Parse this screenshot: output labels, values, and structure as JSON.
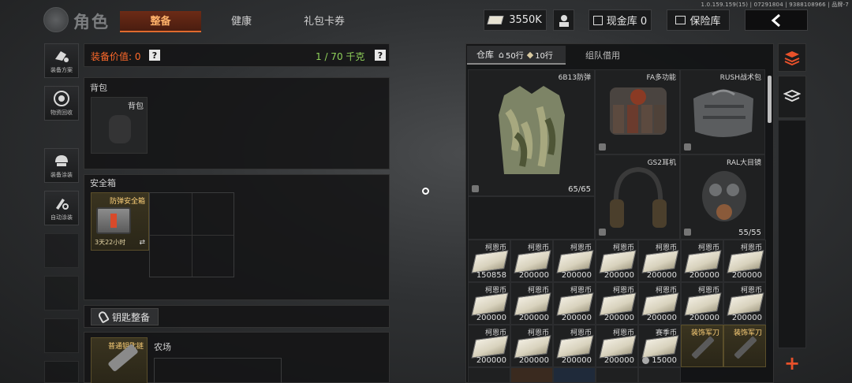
{
  "version": "1.0.159.159(15) | 07291804 | 9388108966 | 品牌-7",
  "header": {
    "logo_text": "角色",
    "tabs": [
      {
        "label": "整备",
        "active": true
      },
      {
        "label": "健康",
        "active": false
      },
      {
        "label": "礼包卡券",
        "active": false
      }
    ],
    "currency": "3550K",
    "cash_label": "现金库 0",
    "safe_label": "保险库"
  },
  "sidebar": [
    {
      "label": "装备方案",
      "icon": "loadout-icon"
    },
    {
      "label": "物资回收",
      "icon": "recycle-icon"
    },
    {
      "label": "装备涂装",
      "icon": "helmet-paint-icon"
    },
    {
      "label": "自动涂装",
      "icon": "auto-paint-icon"
    }
  ],
  "equipment": {
    "value_label": "装备价值: 0",
    "weight": "1 / 70 千克",
    "backpack_title": "背包",
    "backpack_slot_label": "背包",
    "safebox_title": "安全箱",
    "safebox_item": "防弹安全箱",
    "safebox_timer": "3天22小时",
    "key_button": "钥匙整备",
    "key_item": "普通钥匙链",
    "key_location": "农场"
  },
  "storage": {
    "tab_warehouse": "仓库",
    "rows_50": "50行",
    "rows_10": "10行",
    "tab_team": "组队借用",
    "large_items": [
      {
        "name": "6B13防弹",
        "count": "65/65"
      },
      {
        "name": "FA多功能",
        "count": ""
      },
      {
        "name": "RUSH战术包",
        "count": ""
      },
      {
        "name": "GS2耳机",
        "count": ""
      },
      {
        "name": "RAL大目镜",
        "count": "55/55"
      }
    ],
    "money_rows": [
      [
        {
          "name": "柯恩币",
          "count": "150858"
        },
        {
          "name": "柯恩币",
          "count": "200000"
        },
        {
          "name": "柯恩币",
          "count": "200000"
        },
        {
          "name": "柯恩币",
          "count": "200000"
        },
        {
          "name": "柯恩币",
          "count": "200000"
        },
        {
          "name": "柯恩币",
          "count": "200000"
        },
        {
          "name": "柯恩币",
          "count": "200000"
        }
      ],
      [
        {
          "name": "柯恩币",
          "count": "200000"
        },
        {
          "name": "柯恩币",
          "count": "200000"
        },
        {
          "name": "柯恩币",
          "count": "200000"
        },
        {
          "name": "柯恩币",
          "count": "200000"
        },
        {
          "name": "柯恩币",
          "count": "200000"
        },
        {
          "name": "柯恩币",
          "count": "200000"
        },
        {
          "name": "柯恩币",
          "count": "200000"
        }
      ],
      [
        {
          "name": "柯恩币",
          "count": "200000"
        },
        {
          "name": "柯恩币",
          "count": "200000"
        },
        {
          "name": "柯恩币",
          "count": "200000"
        },
        {
          "name": "柯恩币",
          "count": "200000"
        },
        {
          "name": "赛季币",
          "count": "15000"
        },
        {
          "name": "装饰军刀",
          "count": ""
        },
        {
          "name": "装饰军刀",
          "count": ""
        }
      ]
    ],
    "add_symbol": "+"
  },
  "colors": {
    "accent_orange": "#ff6a2a",
    "weight_green": "#8fd15a",
    "gold": "#ffd27a"
  }
}
